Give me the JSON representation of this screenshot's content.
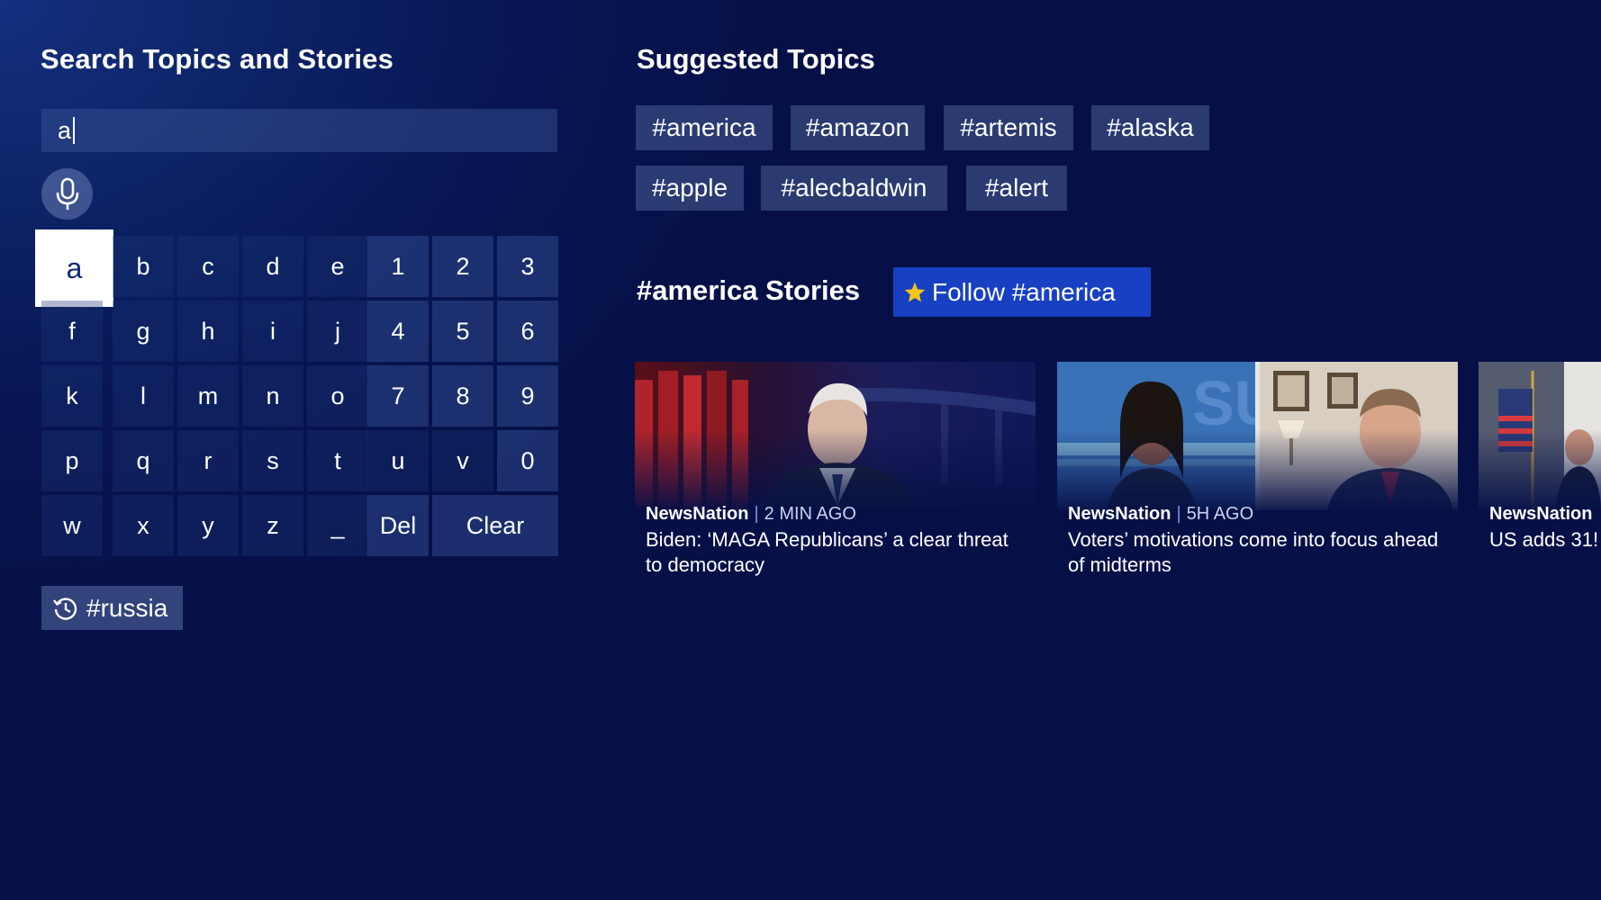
{
  "search": {
    "title": "Search Topics and Stories",
    "query": "a"
  },
  "keyboard": {
    "keys": [
      "a",
      "b",
      "c",
      "d",
      "e",
      "1",
      "2",
      "3",
      "f",
      "g",
      "h",
      "i",
      "j",
      "4",
      "5",
      "6",
      "k",
      "l",
      "m",
      "n",
      "o",
      "7",
      "8",
      "9",
      "p",
      "q",
      "r",
      "s",
      "t",
      "u",
      "v",
      "0",
      "w",
      "x",
      "y",
      "z",
      "_",
      "Del",
      "Clear"
    ],
    "focused_key": "a"
  },
  "recent": {
    "label": "#russia",
    "icon": "history-icon"
  },
  "suggested": {
    "title": "Suggested Topics",
    "topics": [
      "#america",
      "#amazon",
      "#artemis",
      "#alaska",
      "#apple",
      "#alecbaldwin",
      "#alert"
    ]
  },
  "stories": {
    "title": "#america Stories",
    "follow_label": "Follow #america",
    "follow_icon": "star-icon",
    "cards": [
      {
        "source": "NewsNation",
        "time": "2 MIN AGO",
        "headline": "Biden: ‘MAGA Republicans’ a clear threat to democracy"
      },
      {
        "source": "NewsNation",
        "time": "5H AGO",
        "headline": "Voters’ motivations come into focus ahead of midterms"
      },
      {
        "source": "NewsNation",
        "time": "",
        "headline": "US adds 31!"
      }
    ]
  },
  "colors": {
    "background": "#061047",
    "accent": "#1740c2",
    "star": "#f5c518",
    "focused_key_text": "#0d2a78"
  }
}
